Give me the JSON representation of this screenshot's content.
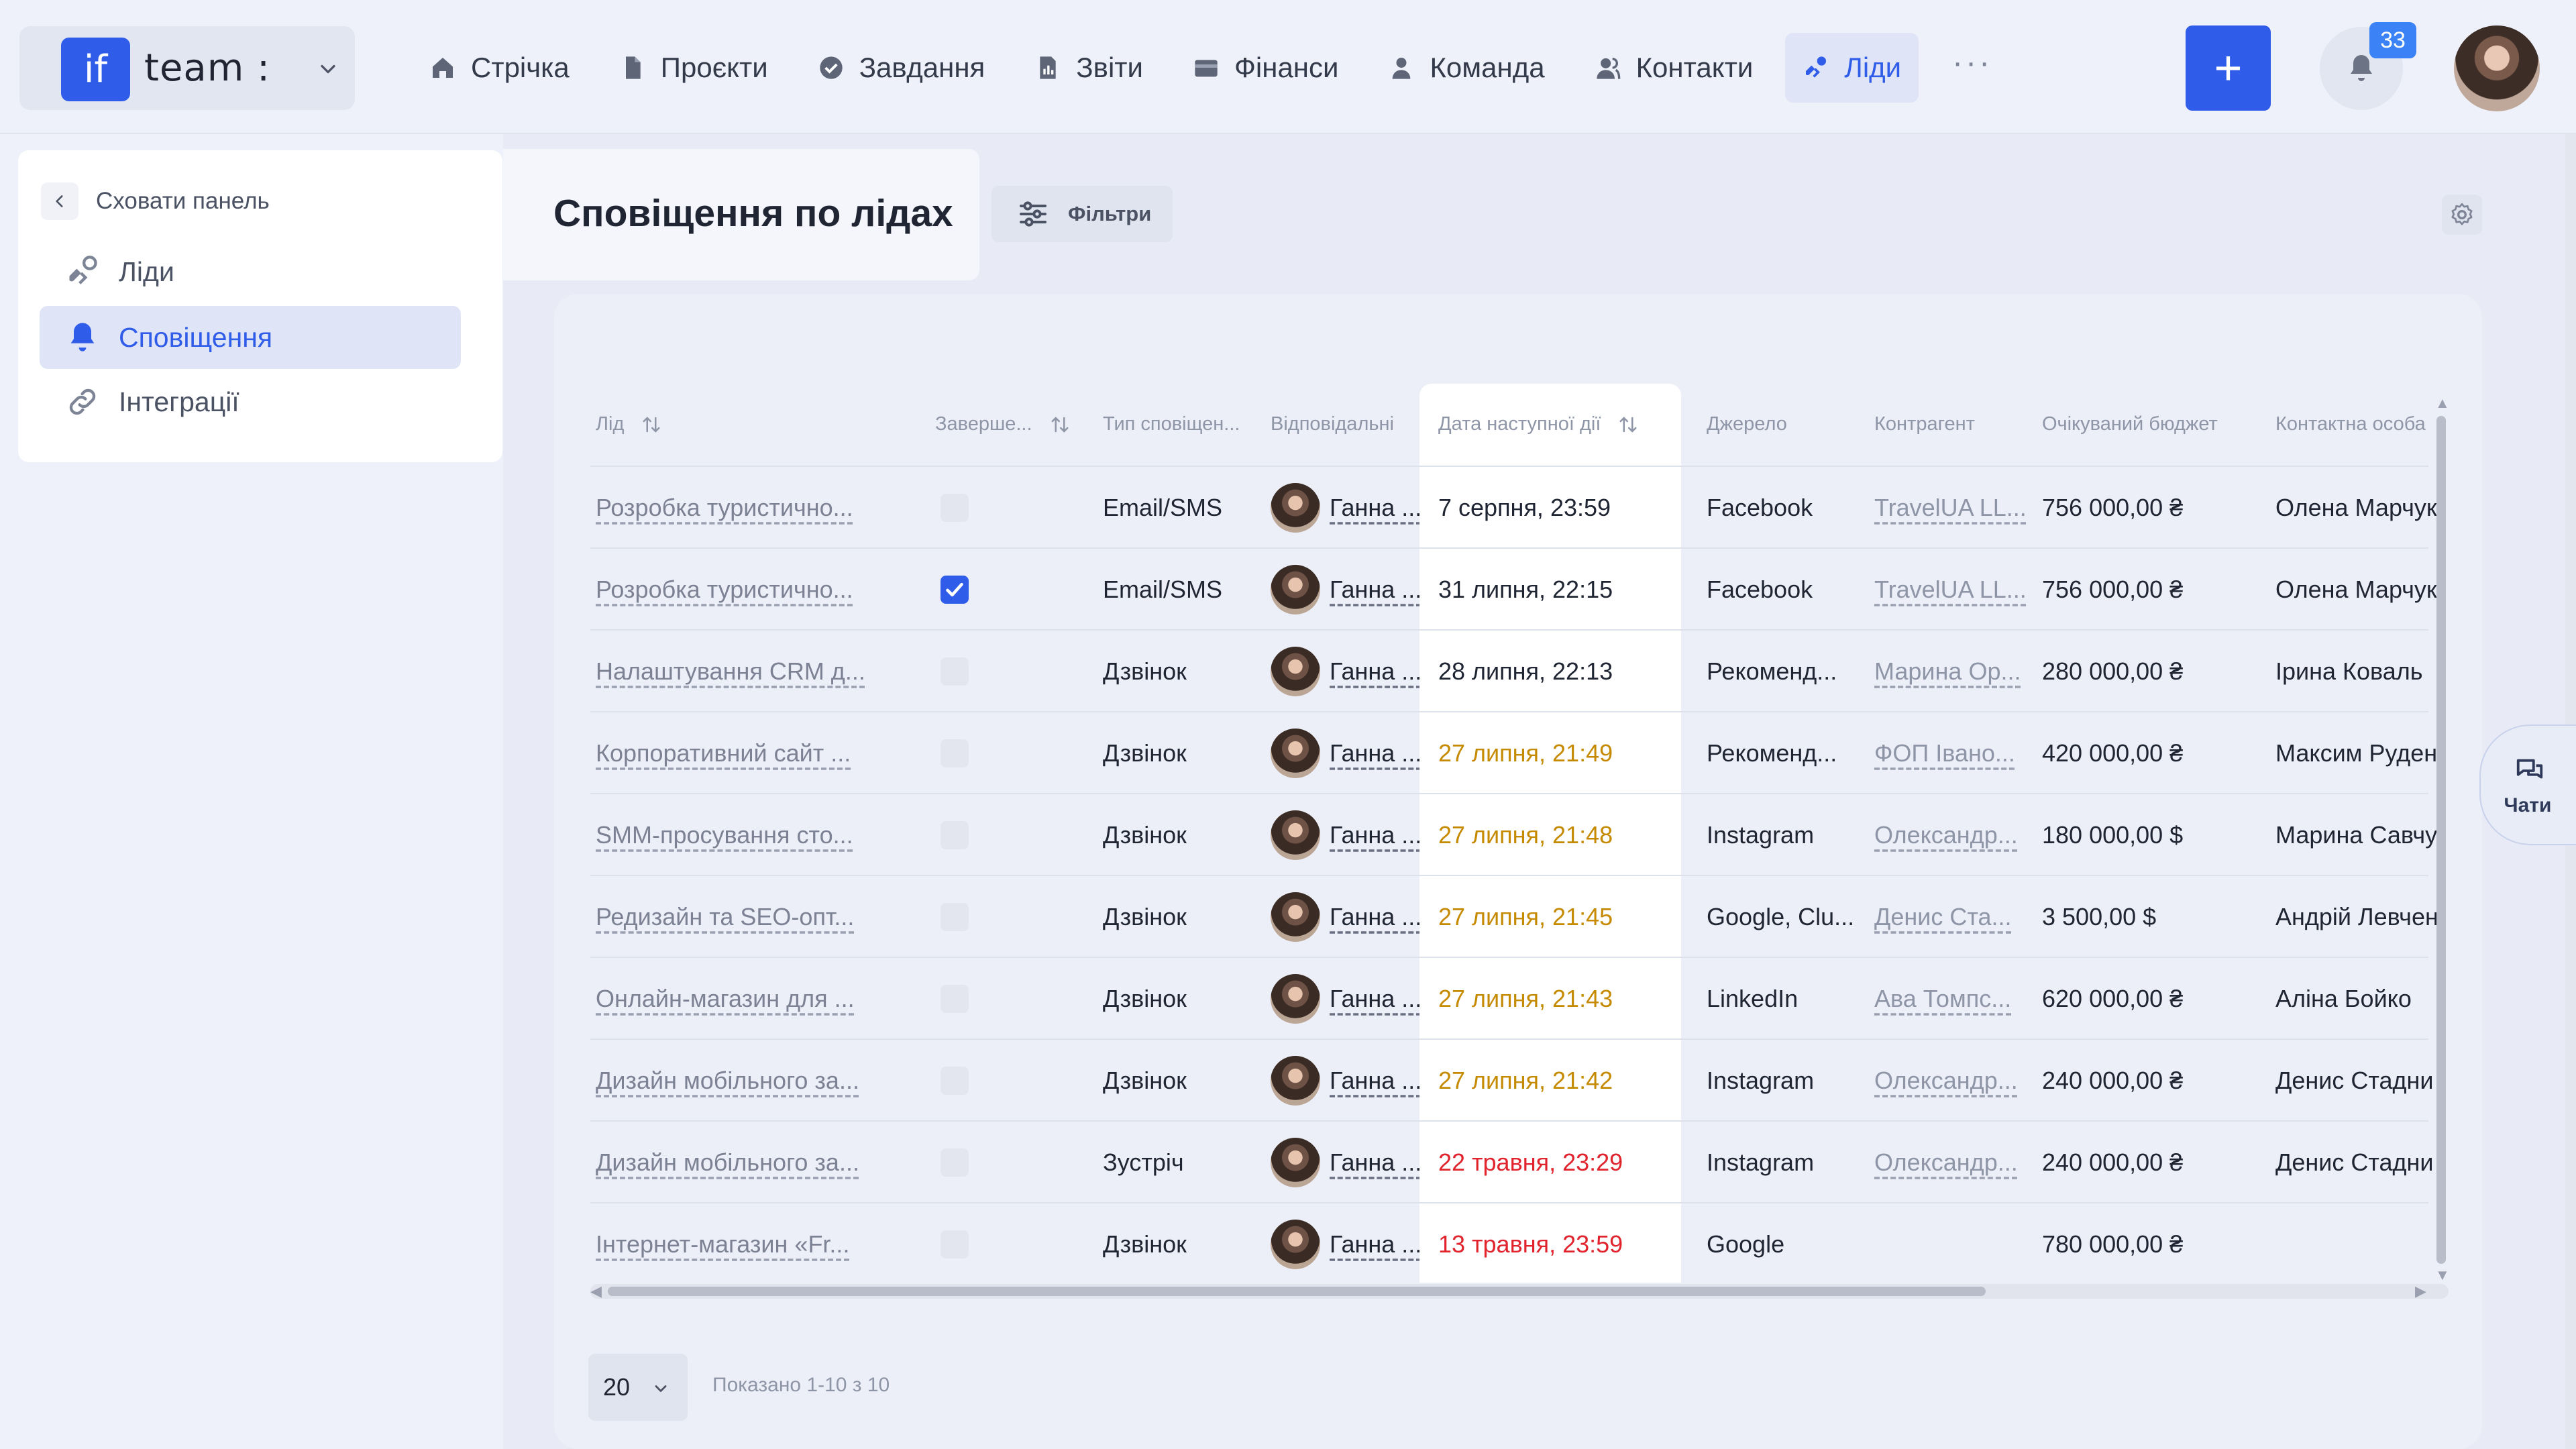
{
  "brand": {
    "logo": "if",
    "name": "team :"
  },
  "nav": [
    {
      "label": "Стрічка",
      "icon": "home-icon"
    },
    {
      "label": "Проєкти",
      "icon": "document-icon"
    },
    {
      "label": "Завдання",
      "icon": "check-circle-icon"
    },
    {
      "label": "Звіти",
      "icon": "report-icon"
    },
    {
      "label": "Фінанси",
      "icon": "wallet-icon"
    },
    {
      "label": "Команда",
      "icon": "user-icon"
    },
    {
      "label": "Контакти",
      "icon": "contacts-icon"
    },
    {
      "label": "Ліди",
      "icon": "leads-icon",
      "active": true
    }
  ],
  "nav_more": "···",
  "add_label": "+",
  "notifications_count": "33",
  "side": {
    "hide_label": "Сховати панель",
    "items": [
      {
        "label": "Ліди",
        "icon": "leads-icon"
      },
      {
        "label": "Сповіщення",
        "icon": "bell-icon",
        "active": true
      },
      {
        "label": "Інтеграції",
        "icon": "link-icon"
      }
    ]
  },
  "page": {
    "title": "Сповіщення по лідах",
    "filters_label": "Фільтри"
  },
  "table": {
    "columns": [
      "Лід",
      "Заверше...",
      "Тип сповіщен...",
      "Відповідальні",
      "Дата наступної дії",
      "Джерело",
      "Контрагент",
      "Очікуваний бюджет",
      "Контактна особа"
    ],
    "rows": [
      {
        "lead": "Розробка туристично...",
        "done": false,
        "type": "Email/SMS",
        "agent": "Ганна ...",
        "date": "7 серпня, 23:59",
        "date_state": "normal",
        "source": "Facebook",
        "counterparty": "TravelUA LL...",
        "budget": "756 000,00 ₴",
        "contact": "Олена Марчук"
      },
      {
        "lead": "Розробка туристично...",
        "done": true,
        "type": "Email/SMS",
        "agent": "Ганна ...",
        "date": "31 липня, 22:15",
        "date_state": "normal",
        "source": "Facebook",
        "counterparty": "TravelUA LL...",
        "budget": "756 000,00 ₴",
        "contact": "Олена Марчук"
      },
      {
        "lead": "Налаштування CRM д...",
        "done": false,
        "type": "Дзвінок",
        "agent": "Ганна ...",
        "date": "28 липня, 22:13",
        "date_state": "normal",
        "source": "Рекоменд...",
        "counterparty": "Марина Ор...",
        "budget": "280 000,00 ₴",
        "contact": "Ірина Коваль"
      },
      {
        "lead": "Корпоративний сайт ...",
        "done": false,
        "type": "Дзвінок",
        "agent": "Ганна ...",
        "date": "27 липня, 21:49",
        "date_state": "warn",
        "source": "Рекоменд...",
        "counterparty": "ФОП Івано...",
        "budget": "420 000,00 ₴",
        "contact": "Максим Руден"
      },
      {
        "lead": "SMM-просування сто...",
        "done": false,
        "type": "Дзвінок",
        "agent": "Ганна ...",
        "date": "27 липня, 21:48",
        "date_state": "warn",
        "source": "Instagram",
        "counterparty": "Олександр...",
        "budget": "180 000,00 $",
        "contact": "Марина Савчу"
      },
      {
        "lead": "Редизайн та SEO-опт...",
        "done": false,
        "type": "Дзвінок",
        "agent": "Ганна ...",
        "date": "27 липня, 21:45",
        "date_state": "warn",
        "source": "Google, Clu...",
        "counterparty": "Денис Ста...",
        "budget": "3 500,00 $",
        "contact": "Андрій Левчен"
      },
      {
        "lead": "Онлайн-магазин для ...",
        "done": false,
        "type": "Дзвінок",
        "agent": "Ганна ...",
        "date": "27 липня, 21:43",
        "date_state": "warn",
        "source": "LinkedIn",
        "counterparty": "Ава Томпс...",
        "budget": "620 000,00 ₴",
        "contact": "Аліна Бойко"
      },
      {
        "lead": "Дизайн мобільного за...",
        "done": false,
        "type": "Дзвінок",
        "agent": "Ганна ...",
        "date": "27 липня, 21:42",
        "date_state": "warn",
        "source": "Instagram",
        "counterparty": "Олександр...",
        "budget": "240 000,00 ₴",
        "contact": "Денис Стадни"
      },
      {
        "lead": "Дизайн мобільного за...",
        "done": false,
        "type": "Зустріч",
        "agent": "Ганна ...",
        "date": "22 травня, 23:29",
        "date_state": "danger",
        "source": "Instagram",
        "counterparty": "Олександр...",
        "budget": "240 000,00 ₴",
        "contact": "Денис Стадни"
      },
      {
        "lead": "Інтернет-магазин «Fr...",
        "done": false,
        "type": "Дзвінок",
        "agent": "Ганна ...",
        "date": "13 травня, 23:59",
        "date_state": "danger",
        "source": "Google",
        "counterparty": "",
        "budget": "780 000,00 ₴",
        "contact": ""
      }
    ]
  },
  "footer": {
    "page_size": "20",
    "shown_text": "Показано 1-10 з 10"
  },
  "chats_label": "Чати",
  "colors": {
    "accent": "#2f5ce9",
    "warn": "#c58a00",
    "danger": "#e0232d",
    "badge": "#3b82f6"
  }
}
